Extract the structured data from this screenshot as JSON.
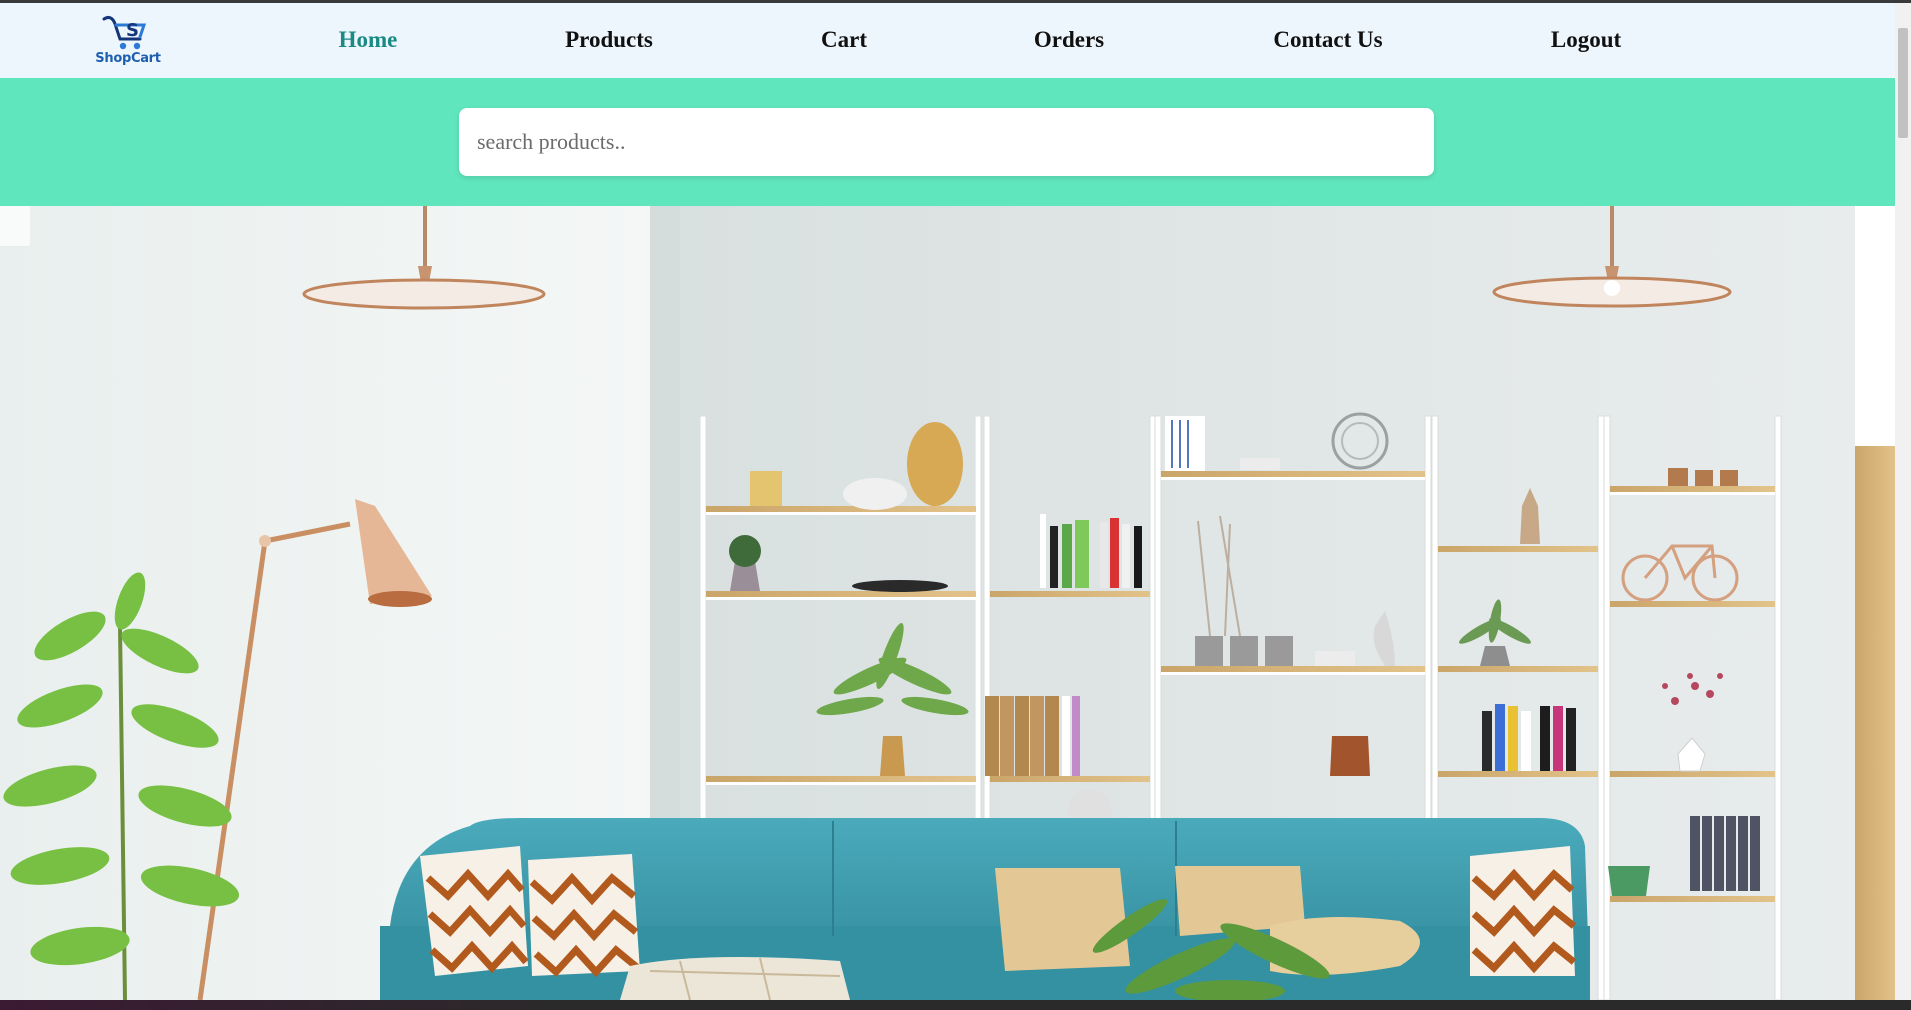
{
  "logo": {
    "text": "ShopCart",
    "icon": "shopping-cart-logo-icon"
  },
  "nav": {
    "items": [
      {
        "label": "Home",
        "active": true
      },
      {
        "label": "Products",
        "active": false
      },
      {
        "label": "Cart",
        "active": false
      },
      {
        "label": "Orders",
        "active": false
      },
      {
        "label": "Contact Us",
        "active": false
      },
      {
        "label": "Logout",
        "active": false
      }
    ]
  },
  "search": {
    "placeholder": "search products..",
    "value": ""
  },
  "hero": {
    "image": "living-room-interior-photo"
  },
  "colors": {
    "nav_bg": "#eef6fd",
    "nav_active": "#1a8a84",
    "search_band": "#60e6bd",
    "sofa": "#3e9fb0"
  }
}
